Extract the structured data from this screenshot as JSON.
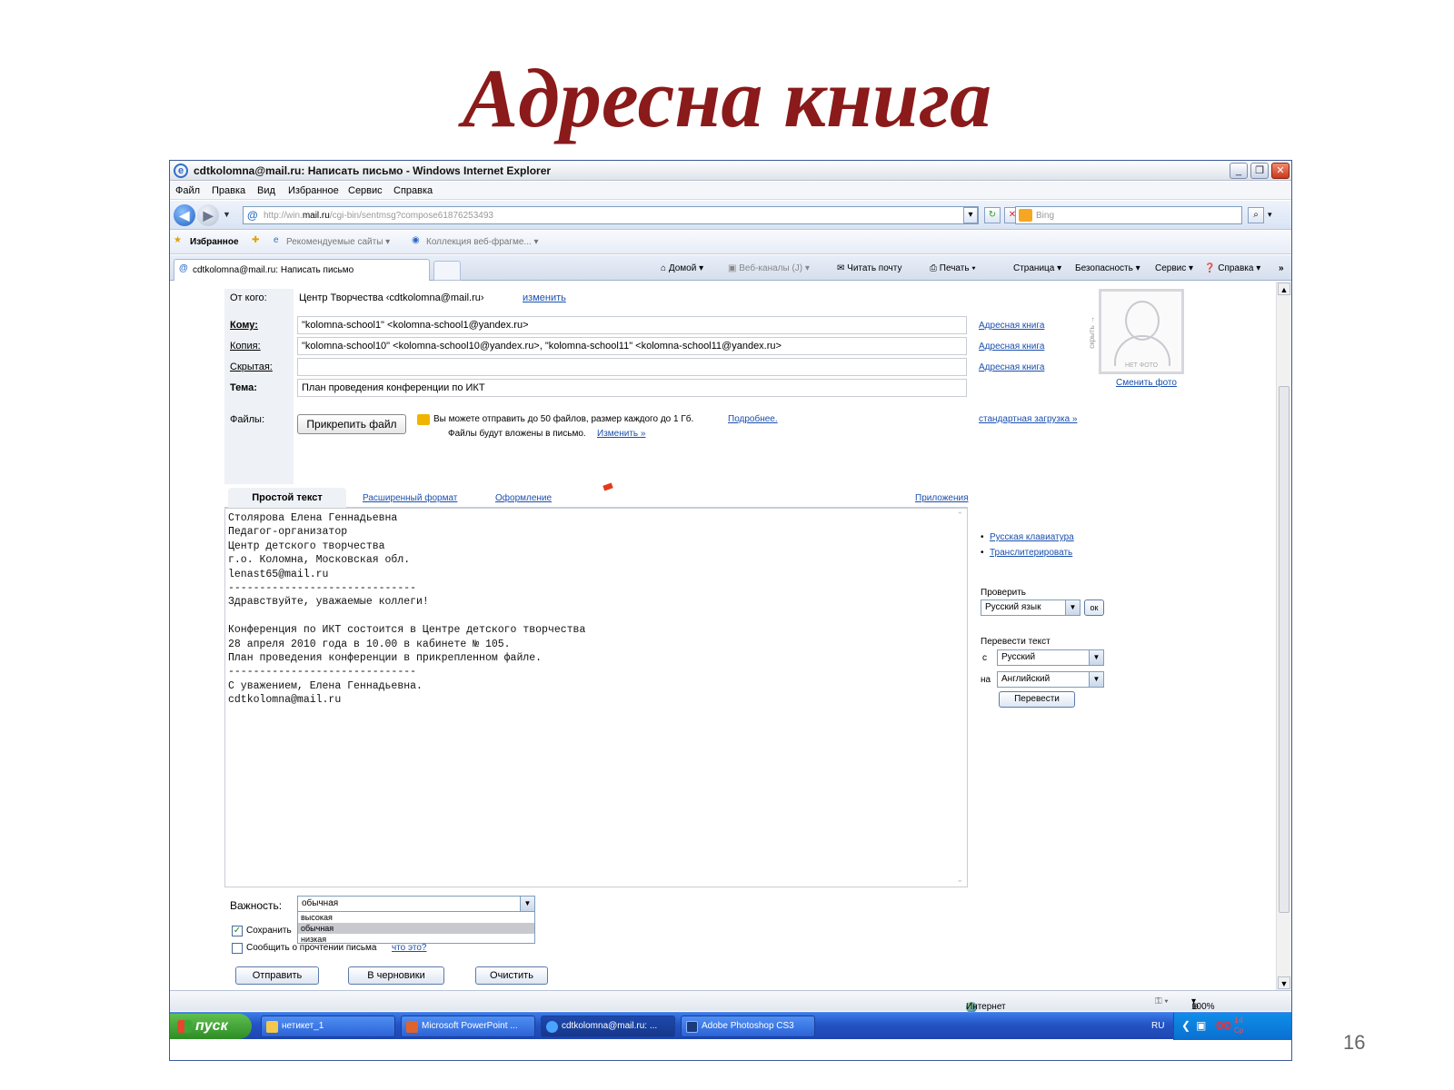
{
  "slide": {
    "title": "Адресна книга",
    "page_number": "16"
  },
  "window": {
    "title": "cdtkolomna@mail.ru: Написать письмо - Windows Internet Explorer"
  },
  "menu": [
    "Файл",
    "Правка",
    "Вид",
    "Избранное",
    "Сервис",
    "Справка"
  ],
  "address": {
    "url_prefix": "http://win.",
    "url_domain": "mail.ru",
    "url_path": "/cgi-bin/sentmsg?compose61876253493",
    "search_placeholder": "Bing"
  },
  "favorites": {
    "label": "Избранное",
    "items": [
      "Рекомендуемые сайты ▾",
      "Коллекция веб-фрагме... ▾"
    ]
  },
  "tabbar": {
    "tab_label": "cdtkolomna@mail.ru: Написать письмо",
    "commands": [
      "Домой",
      "Веб-каналы (J)",
      "Читать почту",
      "Печать",
      "Страница ▾",
      "Безопасность ▾",
      "Сервис ▾",
      "Справка ▾"
    ]
  },
  "compose": {
    "from_label": "От кого:",
    "from_value": "Центр Творчества ‹cdtkolomna@mail.ru›",
    "from_change": "изменить",
    "to_label": "Кому:",
    "to_value": "\"kolomna-school1\" <kolomna-school1@yandex.ru>",
    "cc_label": "Копия:",
    "cc_value": "\"kolomna-school10\" <kolomna-school10@yandex.ru>, \"kolomna-school11\" <kolomna-school11@yandex.ru>",
    "bcc_label": "Скрытая:",
    "bcc_value": "",
    "subject_label": "Тема:",
    "subject_value": "План проведения конференции по ИКТ",
    "address_book": "Адресная книга",
    "files_label": "Файлы:",
    "attach_button": "Прикрепить файл",
    "files_info": "Вы можете отправить до 50 файлов, размер каждого до 1 Гб.",
    "files_more": "Подробнее.",
    "files_info2": "Файлы будут вложены в письмо.",
    "files_change": "Изменить »",
    "std_upload": "стандартная загрузка »",
    "hide_side": "скрыть →",
    "no_photo": "НЕТ ФОТО",
    "change_photo": "Сменить фото"
  },
  "editor": {
    "tab_plain": "Простой текст",
    "tab_rich": "Расширенный формат",
    "tab_design": "Оформление",
    "tab_apps": "Приложения",
    "body": "Столярова Елена Геннадьевна\nПедагог-организатор\nЦентр детского творчества\nг.о. Коломна, Московская обл.\nlenast65@mail.ru\n------------------------------\nЗдравствуйте, уважаемые коллеги!\n\nКонференция по ИКТ состоится в Центре детского творчества\n28 апреля 2010 года в 10.00 в кабинете № 105.\nПлан проведения конференции в прикрепленном файле.\n------------------------------\nС уважением, Елена Геннадьевна.\ncdtkolomna@mail.ru"
  },
  "sidebar": {
    "rus_keyboard": "Русская клавиатура",
    "transliterate": "Транслитерировать",
    "check_label": "Проверить",
    "check_lang": "Русский язык",
    "ok": "ок",
    "translate_label": "Перевести текст",
    "from_prefix": "с",
    "from_lang": "Русский",
    "to_prefix": "на",
    "to_lang": "Английский",
    "translate_button": "Перевести"
  },
  "bottom": {
    "priority_label": "Важность:",
    "priority_value": "обычная",
    "priority_options": [
      "высокая",
      "обычная",
      "низкая"
    ],
    "save_copy": "Сохранить",
    "notify": "Сообщить о прочтении письма",
    "whats_this": "что это?",
    "send": "Отправить",
    "drafts": "В черновики",
    "clear": "Очистить"
  },
  "status": {
    "zone": "Интернет",
    "zoom": "100%"
  },
  "taskbar": {
    "start": "пуск",
    "tasks": [
      "нетикет_1",
      "Microsoft PowerPoint ...",
      "cdtkolomna@mail.ru: ...",
      "Adobe Photoshop CS3"
    ],
    "lang": "RU",
    "clock_h": "00",
    "clock_m": "14",
    "clock_d": "Ср"
  }
}
